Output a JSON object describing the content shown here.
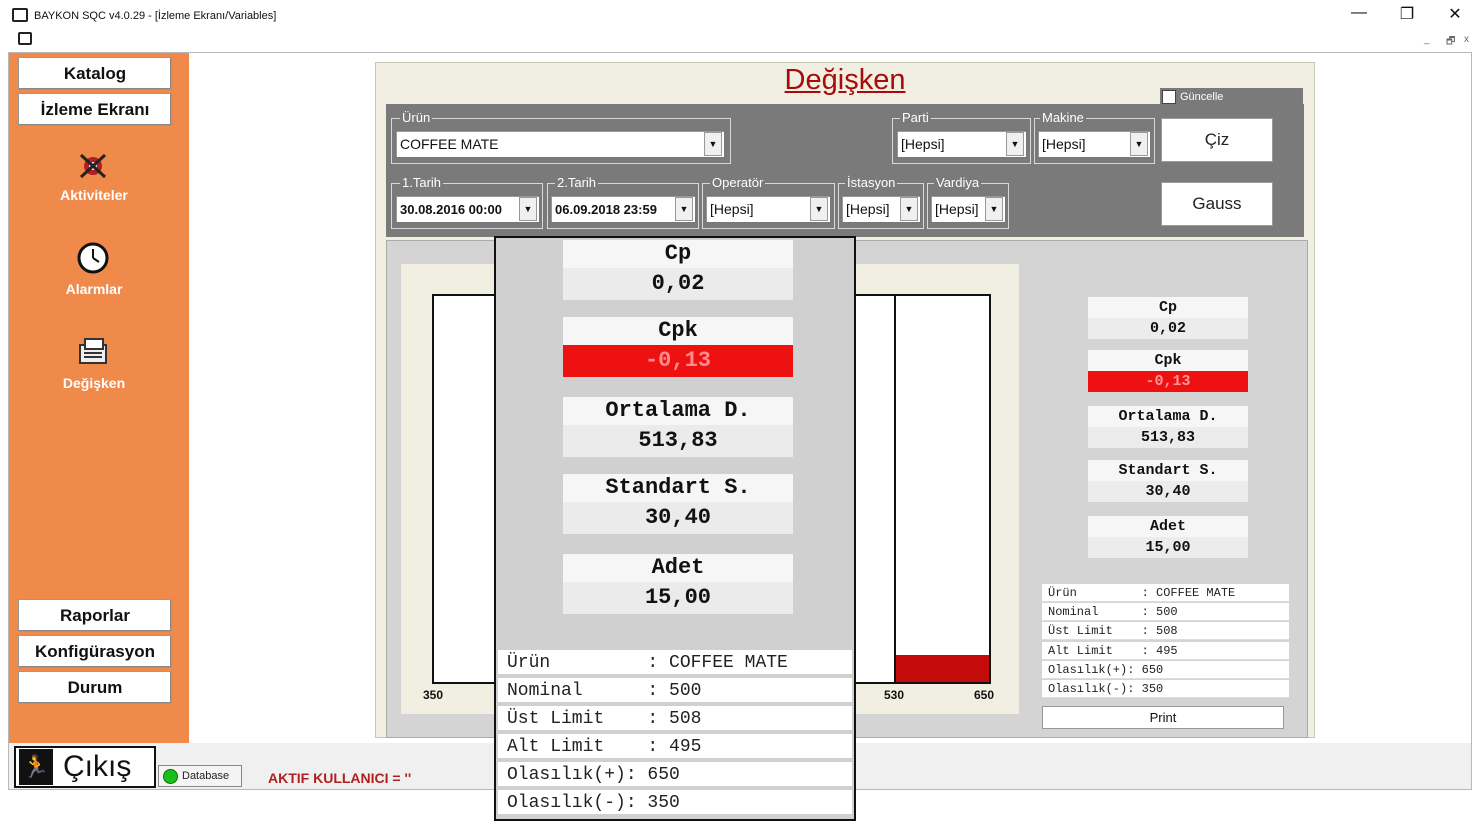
{
  "window": {
    "title": "BAYKON SQC v4.0.29 - [İzleme Ekranı/Variables]",
    "minimize": "—",
    "restore": "❐",
    "close": "✕",
    "mdi_min": "_",
    "mdi_restore": "🗗",
    "mdi_close": "x"
  },
  "sidebar": {
    "katalog": "Katalog",
    "izleme": "İzleme Ekranı",
    "aktiviteler": "Aktiviteler",
    "alarmlar": "Alarmlar",
    "degisken": "Değişken",
    "raporlar": "Raporlar",
    "konfigurasyon": "Konfigürasyon",
    "durum": "Durum"
  },
  "status": {
    "exit_label": "Çıkış",
    "database": "Database",
    "active_user": "AKTIF KULLANICI = ''"
  },
  "panel": {
    "title": "Değişken",
    "guncelle": "Güncelle"
  },
  "filters": {
    "urun": {
      "label": "Ürün",
      "value": "COFFEE MATE"
    },
    "parti": {
      "label": "Parti",
      "value": "[Hepsi]"
    },
    "makine": {
      "label": "Makine",
      "value": "[Hepsi]"
    },
    "tarih1": {
      "label": "1.Tarih",
      "value": "30.08.2016 00:00"
    },
    "tarih2": {
      "label": "2.Tarih",
      "value": "06.09.2018 23:59"
    },
    "operator": {
      "label": "Operatör",
      "value": "[Hepsi]"
    },
    "istasyon": {
      "label": "İstasyon",
      "value": "[Hepsi]"
    },
    "vardiya": {
      "label": "Vardiya",
      "value": "[Hepsi]"
    },
    "ciz": "Çiz",
    "gauss": "Gauss"
  },
  "chart": {
    "ticks": [
      "350",
      "530",
      "650"
    ]
  },
  "stats": {
    "cp_label": "Cp",
    "cp": "0,02",
    "cpk_label": "Cpk",
    "cpk": "-0,13",
    "mean_label": "Ortalama D.",
    "mean": "513,83",
    "std_label": "Standart S.",
    "std": "30,40",
    "count_label": "Adet",
    "count": "15,00",
    "colors": {
      "cpk_bad": "#ee1111"
    }
  },
  "info": {
    "urun": "Ürün         : COFFEE MATE",
    "nominal": "Nominal      : 500",
    "ust": "Üst Limit    : 508",
    "alt": "Alt Limit    : 495",
    "olas_plus": "Olasılık(+): 650",
    "olas_minus": "Olasılık(-): 350",
    "print": "Print"
  }
}
